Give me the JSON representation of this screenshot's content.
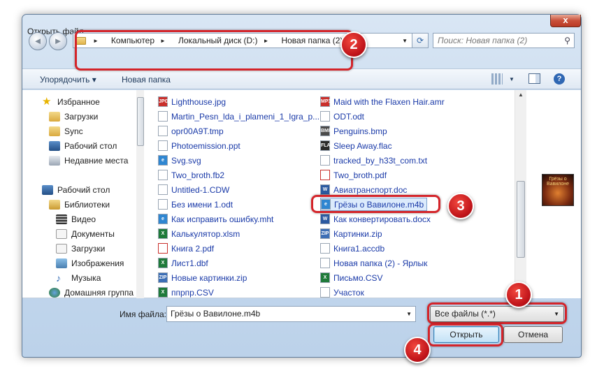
{
  "window": {
    "title": "Открыть файл",
    "close": "x"
  },
  "nav": {
    "back": "◄",
    "forward": "►"
  },
  "address": {
    "crumbs": [
      "Компьютер",
      "Локальный диск (D:)",
      "Новая папка (2)"
    ],
    "separator": "►",
    "dropdown": "▼"
  },
  "refresh": "⟳",
  "search": {
    "placeholder": "Поиск: Новая папка (2)",
    "icon": "⚲"
  },
  "toolbar": {
    "organize": "Упорядочить ▾",
    "new_folder": "Новая папка",
    "view_dd": "▼",
    "help": "?"
  },
  "sidebar": {
    "items": [
      {
        "label": "Избранное",
        "icon": "star-icon"
      },
      {
        "label": "Загрузки",
        "icon": "downloads-folder-icon"
      },
      {
        "label": "Sync",
        "icon": "folder-icon"
      },
      {
        "label": "Рабочий стол",
        "icon": "desktop-icon"
      },
      {
        "label": "Недавние места",
        "icon": "recent-places-icon"
      },
      {
        "label": "Рабочий стол",
        "icon": "desktop-icon"
      },
      {
        "label": "Библиотеки",
        "icon": "libraries-icon"
      },
      {
        "label": "Видео",
        "icon": "video-icon"
      },
      {
        "label": "Документы",
        "icon": "documents-icon"
      },
      {
        "label": "Загрузки",
        "icon": "downloads-icon"
      },
      {
        "label": "Изображения",
        "icon": "images-icon"
      },
      {
        "label": "Музыка",
        "icon": "music-icon"
      },
      {
        "label": "Домашняя группа",
        "icon": "homegroup-icon"
      }
    ]
  },
  "files": {
    "col1": [
      {
        "name": "Lighthouse.jpg",
        "icon": "jpg-icon",
        "tag": "JPG"
      },
      {
        "name": "Martin_Pesn_lda_i_plameni_1_Igra_p...",
        "icon": "document-icon",
        "tag": ""
      },
      {
        "name": "opr00A9T.tmp",
        "icon": "tmp-icon",
        "tag": ""
      },
      {
        "name": "Photoemission.ppt",
        "icon": "document-icon",
        "tag": ""
      },
      {
        "name": "Svg.svg",
        "icon": "svg-icon",
        "tag": "e"
      },
      {
        "name": "Two_broth.fb2",
        "icon": "document-icon",
        "tag": ""
      },
      {
        "name": "Untitled-1.CDW",
        "icon": "document-icon",
        "tag": ""
      },
      {
        "name": "Без имени 1.odt",
        "icon": "odt-icon",
        "tag": ""
      },
      {
        "name": "Как исправить ошибку.mht",
        "icon": "mht-icon",
        "tag": "e"
      },
      {
        "name": "Калькулятор.xlsm",
        "icon": "excel-icon",
        "tag": "X"
      },
      {
        "name": "Книга 2.pdf",
        "icon": "pdf-icon",
        "tag": ""
      },
      {
        "name": "Лист1.dbf",
        "icon": "dbf-icon",
        "tag": "X"
      },
      {
        "name": "Новые картинки.zip",
        "icon": "zip-icon",
        "tag": "ZIP"
      },
      {
        "name": "ппрпр.CSV",
        "icon": "csv-icon",
        "tag": "X"
      }
    ],
    "col2": [
      {
        "name": "Maid with the Flaxen Hair.amr",
        "icon": "amr-icon",
        "tag": "MP3"
      },
      {
        "name": "ODT.odt",
        "icon": "odt-icon",
        "tag": ""
      },
      {
        "name": "Penguins.bmp",
        "icon": "bmp-icon",
        "tag": "BMP"
      },
      {
        "name": "Sleep Away.flac",
        "icon": "flac-icon",
        "tag": "FLAC"
      },
      {
        "name": "tracked_by_h33t_com.txt",
        "icon": "txt-icon",
        "tag": ""
      },
      {
        "name": "Two_broth.pdf",
        "icon": "pdf-icon",
        "tag": ""
      },
      {
        "name": "Авиатранспорт.doc",
        "icon": "word-icon",
        "tag": "W"
      },
      {
        "name": "Грёзы о Вавилоне.m4b",
        "icon": "m4b-icon",
        "tag": "e"
      },
      {
        "name": "Как конвертировать.docx",
        "icon": "word-icon",
        "tag": "W"
      },
      {
        "name": "Картинки.zip",
        "icon": "zip-icon",
        "tag": "ZIP"
      },
      {
        "name": "Книга1.accdb",
        "icon": "document-icon",
        "tag": ""
      },
      {
        "name": "Новая папка (2) - Ярлык",
        "icon": "shortcut-icon",
        "tag": ""
      },
      {
        "name": "Письмо.CSV",
        "icon": "csv-icon",
        "tag": "X"
      },
      {
        "name": "Участок",
        "icon": "document-icon",
        "tag": ""
      }
    ],
    "selected": "Грёзы о Вавилоне.m4b"
  },
  "preview": {
    "cover_text": "Грёзы о Вавилоне"
  },
  "bottom": {
    "filename_label": "Имя файла:",
    "filename_value": "Грёзы о Вавилоне.m4b",
    "filter_value": "Все файлы (*.*)",
    "open_label": "Открыть",
    "cancel_label": "Отмена"
  },
  "callouts": [
    "1",
    "2",
    "3",
    "4"
  ],
  "colors": {
    "callout": "#d4242a",
    "link_text": "#1a3aa8",
    "selection": "#dcebfc"
  }
}
